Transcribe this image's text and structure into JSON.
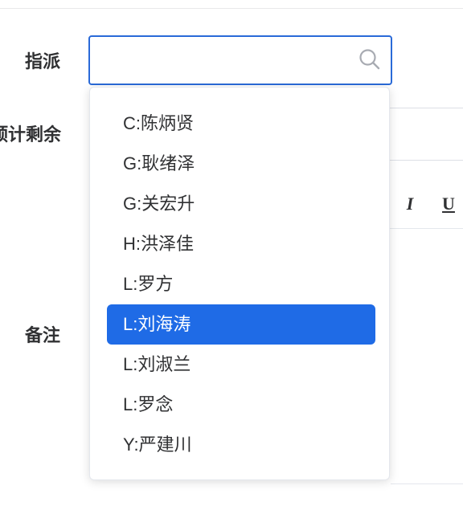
{
  "form": {
    "assign_label": "指派",
    "remaining_label": "计剩余",
    "remaining_label_clipped_prefix": "预",
    "note_label": "备注"
  },
  "assign_select": {
    "value": "",
    "placeholder": "",
    "icon": "search-icon",
    "border_color": "#2a6ad8"
  },
  "editor_toolbar": {
    "italic_label": "I",
    "underline_label": "U"
  },
  "dropdown": {
    "selected_index": 5,
    "highlight_color": "#1f6be6",
    "options": [
      {
        "label": "C:陈炳贤"
      },
      {
        "label": "G:耿绪泽"
      },
      {
        "label": "G:关宏升"
      },
      {
        "label": "H:洪泽佳"
      },
      {
        "label": "L:罗方"
      },
      {
        "label": "L:刘海涛"
      },
      {
        "label": "L:刘淑兰"
      },
      {
        "label": "L:罗念"
      },
      {
        "label": "Y:严建川"
      }
    ]
  }
}
